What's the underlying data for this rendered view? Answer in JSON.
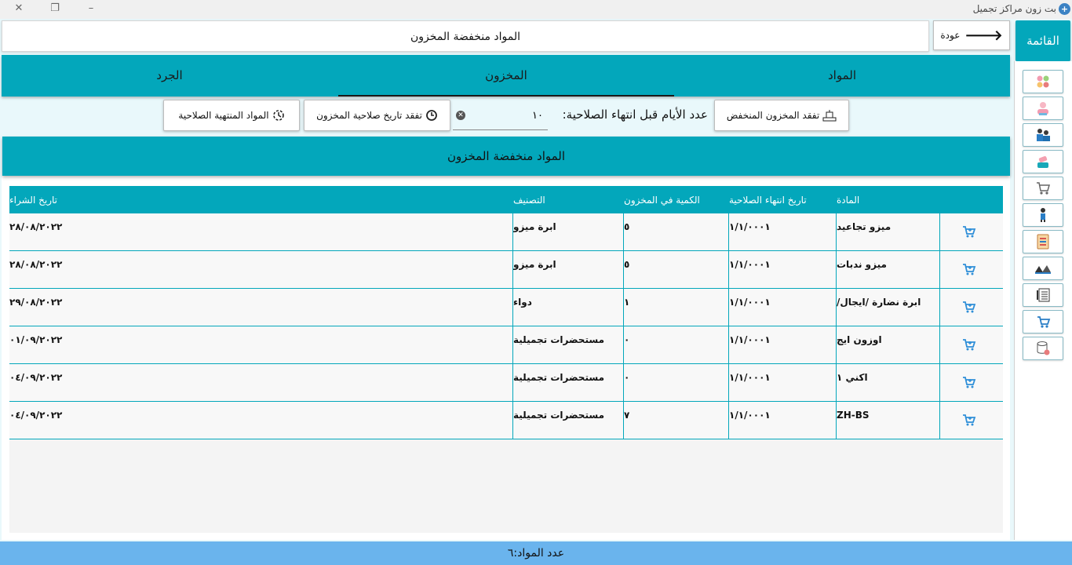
{
  "window": {
    "title": "بت زون مراكز تجميل",
    "app_icon": "app-logo-icon"
  },
  "header": {
    "page_title": "المواد منخفضة المخزون",
    "back_label": "عودة"
  },
  "menu": {
    "title": "القائمة",
    "items": [
      {
        "icon": "categories-icon"
      },
      {
        "icon": "beauty-clients-icon"
      },
      {
        "icon": "employees-icon"
      },
      {
        "icon": "products-icon"
      },
      {
        "icon": "shopping-cart-icon"
      },
      {
        "icon": "service-icon"
      },
      {
        "icon": "report-icon"
      },
      {
        "icon": "suppliers-icon"
      },
      {
        "icon": "notebook-icon"
      },
      {
        "icon": "sales-icon"
      },
      {
        "icon": "database-icon"
      }
    ]
  },
  "tabs": [
    {
      "label": "المواد",
      "active": false
    },
    {
      "label": "المخزون",
      "active": true
    },
    {
      "label": "الجرد",
      "active": false
    }
  ],
  "toolbar": {
    "check_low_stock": "تفقد المخزون المنخفض",
    "days_label": "عدد الأيام قبل انتهاء الصلاحية:",
    "days_value": "١٠",
    "check_expiry": "تفقد تاريخ صلاحية المخزون",
    "expired_items": "المواد المنتهية الصلاحية"
  },
  "section": {
    "title": "المواد منخفضة المخزون"
  },
  "table": {
    "columns": [
      "المادة",
      "تاريخ انتهاء الصلاحية",
      "الكمية في المخزون",
      "التصنيف",
      "تاريخ الشراء"
    ],
    "rows": [
      [
        "ميزو تجاعيد",
        "١/١/٠٠٠١",
        "٥",
        "ابرة ميزو",
        "٢٨/٠٨/٢٠٢٢"
      ],
      [
        "ميزو ندبات",
        "١/١/٠٠٠١",
        "٥",
        "ابرة ميزو",
        "٢٨/٠٨/٢٠٢٢"
      ],
      [
        "ابرة نضارة /ايجال/",
        "١/١/٠٠٠١",
        "١",
        "دواء",
        "٢٩/٠٨/٢٠٢٢"
      ],
      [
        "اوزون ايج",
        "١/١/٠٠٠١",
        "٠",
        "مستحضرات تجميلية",
        "٠١/٠٩/٢٠٢٢"
      ],
      [
        "اكني ١",
        "١/١/٠٠٠١",
        "٠",
        "مستحضرات تجميلية",
        "٠٤/٠٩/٢٠٢٢"
      ],
      [
        "ZH-BS",
        "١/١/٠٠٠١",
        "٧",
        "مستحضرات تجميلية",
        "٠٤/٠٩/٢٠٢٢"
      ]
    ]
  },
  "status": {
    "count_text": "عدد المواد:٦"
  },
  "colors": {
    "accent": "#03a7bb",
    "status_bar": "#6ab4ed",
    "cart_icon": "#2f8fd8"
  }
}
